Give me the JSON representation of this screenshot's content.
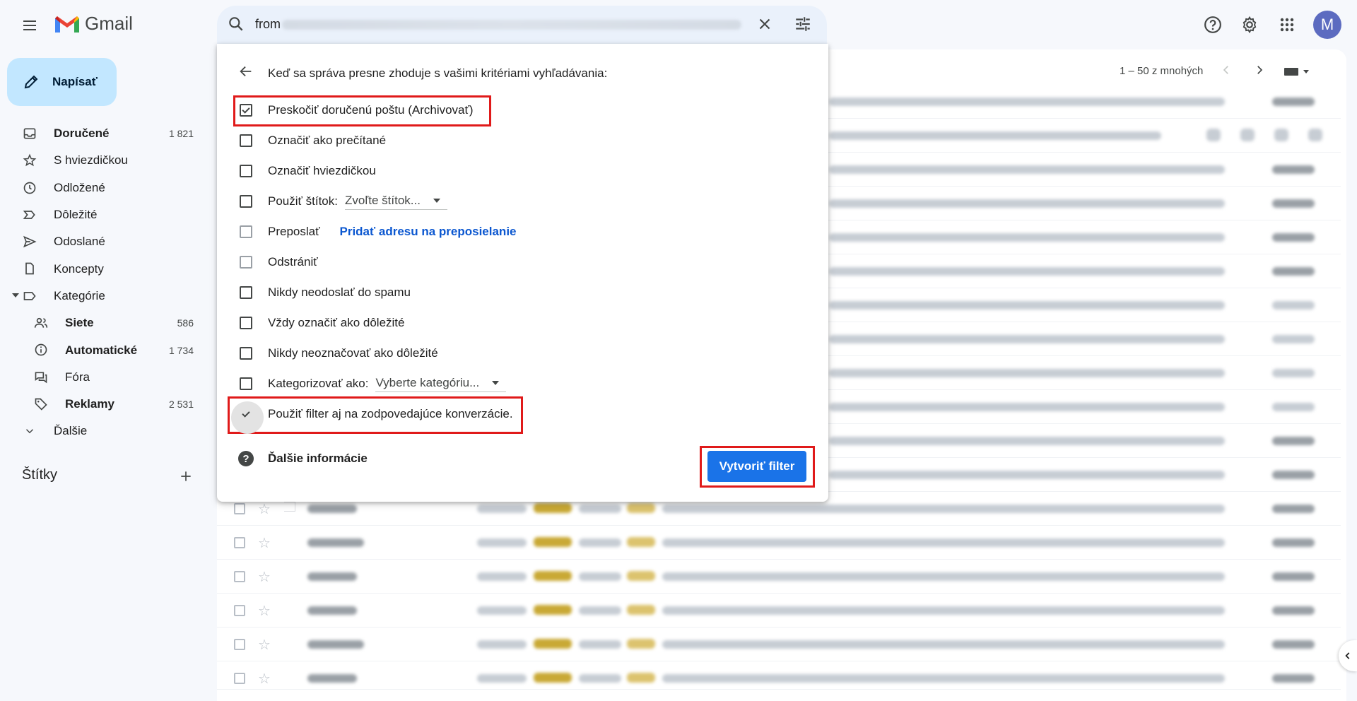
{
  "app": {
    "name": "Gmail"
  },
  "header": {
    "search_text": "from",
    "avatar_letter": "M"
  },
  "sidebar": {
    "compose_label": "Napísať",
    "items": [
      {
        "label": "Doručené",
        "count": "1 821",
        "icon": "inbox-icon"
      },
      {
        "label": "S hviezdičkou",
        "count": "",
        "icon": "star-icon"
      },
      {
        "label": "Odložené",
        "count": "",
        "icon": "clock-icon"
      },
      {
        "label": "Dôležité",
        "count": "",
        "icon": "important-icon"
      },
      {
        "label": "Odoslané",
        "count": "",
        "icon": "send-icon"
      },
      {
        "label": "Koncepty",
        "count": "",
        "icon": "draft-icon"
      },
      {
        "label": "Kategórie",
        "count": "",
        "icon": "label-icon"
      },
      {
        "label": "Siete",
        "count": "586",
        "icon": "people-icon"
      },
      {
        "label": "Automatické",
        "count": "1 734",
        "icon": "info-icon"
      },
      {
        "label": "Fóra",
        "count": "",
        "icon": "forum-icon"
      },
      {
        "label": "Reklamy",
        "count": "2 531",
        "icon": "tag-icon"
      },
      {
        "label": "Ďalšie",
        "count": "",
        "icon": "chevron-down-icon"
      }
    ],
    "labels_title": "Štítky"
  },
  "toolbar": {
    "pagination": "1 – 50 z mnohých"
  },
  "filter_dialog": {
    "heading": "Keď sa správa presne zhoduje s vašimi kritériami vyhľadávania:",
    "options": [
      {
        "label": "Preskočiť doručenú poštu (Archivovať)",
        "checked": true
      },
      {
        "label": "Označiť ako prečítané",
        "checked": false
      },
      {
        "label": "Označiť hviezdičkou",
        "checked": false
      },
      {
        "label": "Použiť štítok:",
        "checked": false,
        "select": "Zvoľte štítok..."
      },
      {
        "label": "Preposlať",
        "checked": false,
        "link": "Pridať adresu na preposielanie"
      },
      {
        "label": "Odstrániť",
        "checked": false
      },
      {
        "label": "Nikdy neodoslať do spamu",
        "checked": false
      },
      {
        "label": "Vždy označiť ako dôležité",
        "checked": false
      },
      {
        "label": "Nikdy neoznačovať ako dôležité",
        "checked": false
      },
      {
        "label": "Kategorizovať ako:",
        "checked": false,
        "select": "Vyberte kategóriu..."
      },
      {
        "label": "Použiť filter aj na zodpovedajúce konverzácie.",
        "checked": true
      }
    ],
    "help_label": "Ďalšie informácie",
    "create_button": "Vytvoriť filter"
  },
  "colors": {
    "accent": "#1a73e8",
    "compose_bg": "#c2e7ff",
    "highlight": "#e01a1a"
  }
}
